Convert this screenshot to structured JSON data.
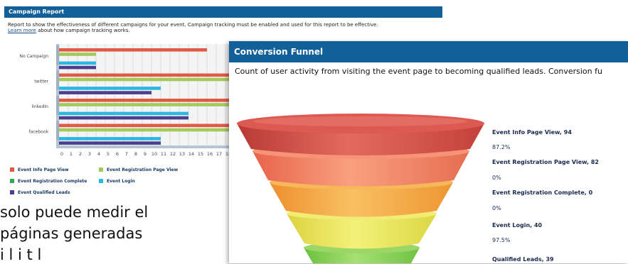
{
  "campaign_report": {
    "title": "Campaign Report",
    "description": "Report to show the effectiveness of different campaigns for your event. Campaign tracking must be enabled and used for this report to be effective.",
    "learn_more_link": "Learn more",
    "learn_more_suffix": " about how campaign tracking works."
  },
  "chart_data": {
    "type": "bar",
    "orientation": "horizontal",
    "categories": [
      "No Campaign",
      "twitter",
      "linkedIn",
      "facebook"
    ],
    "x_ticks": [
      "0",
      "1",
      "2",
      "3",
      "4",
      "5",
      "6",
      "7",
      "8",
      "9",
      "10",
      "11",
      "12",
      "13",
      "14",
      "15",
      "16",
      "17",
      "18",
      "1"
    ],
    "xlim": [
      0,
      19
    ],
    "series": [
      {
        "name": "Event Info Page View",
        "color": "#e05a45",
        "values": [
          16,
          19,
          19,
          19
        ]
      },
      {
        "name": "Event Registration Page View",
        "color": "#a3c95a",
        "values": [
          4,
          19,
          19,
          19
        ]
      },
      {
        "name": "Event Registration Complete",
        "color": "#2eaa55",
        "values": [
          0,
          0,
          0,
          0
        ]
      },
      {
        "name": "Event Login",
        "color": "#2ab8e0",
        "values": [
          4,
          11,
          14,
          11
        ]
      },
      {
        "name": "Event Qualified Leads",
        "color": "#4a3f8f",
        "values": [
          4,
          10,
          14,
          11
        ]
      }
    ],
    "grid": true,
    "legend_position": "bottom"
  },
  "spanish_text": {
    "line1": "solo puede medir el",
    "line2": "páginas generadas",
    "line3": "i  l       i t      l"
  },
  "conversion_funnel": {
    "title": "Conversion Funnel",
    "description": "Count of user activity from visiting the event page to becoming qualified leads. Conversion fu",
    "stages": [
      {
        "label": "Event Info Page View, 94",
        "percent": "87.2%",
        "color": "#d94d46"
      },
      {
        "label": "Event Registration Page View, 82",
        "percent": "0%",
        "color": "#ef7b58"
      },
      {
        "label": "Event Registration Complete, 0",
        "percent": "0%",
        "color": "#f3a43f"
      },
      {
        "label": "Event Login, 40",
        "percent": "97.5%",
        "color": "#e6e05a"
      },
      {
        "label": "Qualified Leads, 39",
        "percent": "",
        "color": "#8fd05a"
      }
    ]
  }
}
